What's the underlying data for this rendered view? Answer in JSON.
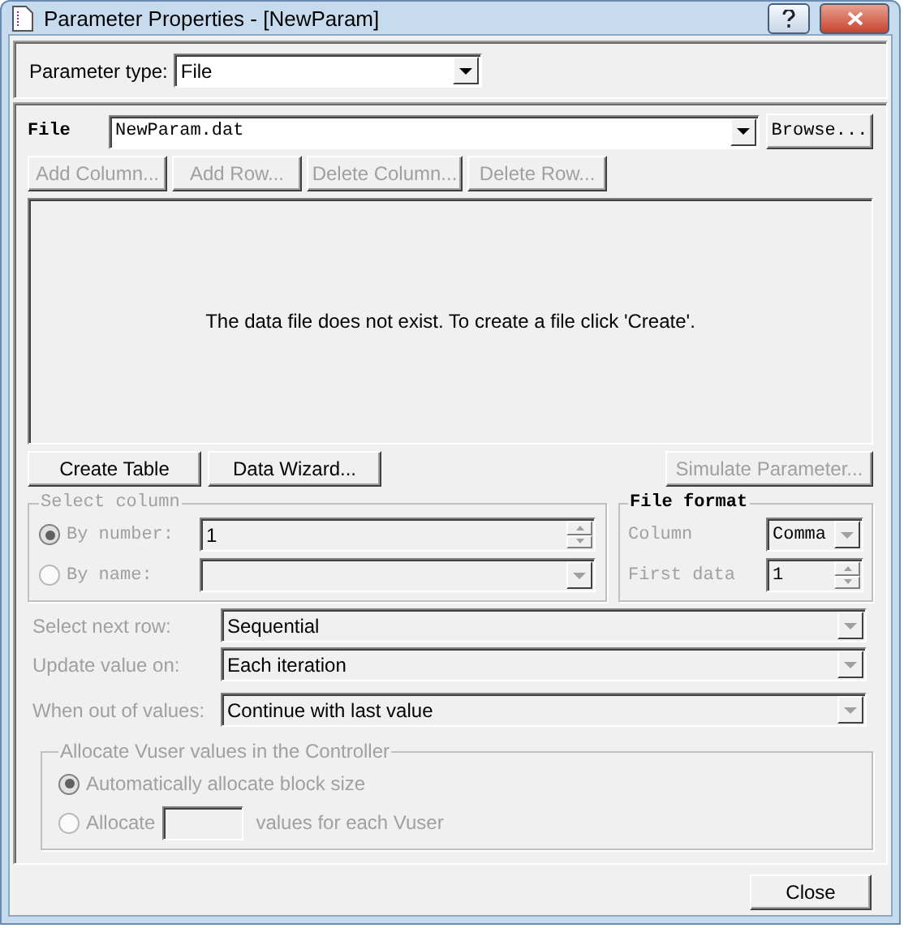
{
  "window": {
    "title": "Parameter Properties - [NewParam]"
  },
  "parameter_type": {
    "label": "Parameter type:",
    "value": "File"
  },
  "file": {
    "label": "File",
    "value": "NewParam.dat",
    "browse": "Browse..."
  },
  "table_buttons": [
    {
      "label": "Add Column...",
      "disabled": true
    },
    {
      "label": "Add Row...",
      "disabled": true
    },
    {
      "label": "Delete Column...",
      "disabled": true
    },
    {
      "label": "Delete Row...",
      "disabled": true
    }
  ],
  "table": {
    "message": "The data file does not exist. To create a file click 'Create'."
  },
  "action_buttons": [
    {
      "label": "Create Table",
      "disabled": false
    },
    {
      "label": "Data Wizard...",
      "disabled": false
    },
    {
      "label": "Simulate Parameter...",
      "disabled": true
    }
  ],
  "select_column": {
    "title": "Select column",
    "disabled": true,
    "options": [
      {
        "label": "By number:",
        "selected": true,
        "kind": "spin",
        "value": "1"
      },
      {
        "label": "By name:",
        "selected": false,
        "kind": "combo"
      }
    ]
  },
  "file_format": {
    "title": "File format",
    "column": {
      "label": "Column",
      "value": "Comma"
    },
    "first_data": {
      "label": "First data",
      "value": "1"
    }
  },
  "settings": [
    {
      "label": "Select next row:",
      "value": "Sequential"
    },
    {
      "label": "Update value on:",
      "value": "Each iteration"
    },
    {
      "label": "When out of values:",
      "value": "Continue with last value"
    }
  ],
  "allocate": {
    "title": "Allocate Vuser values in the Controller",
    "options": [
      {
        "label": "Automatically allocate block size",
        "selected": true
      },
      {
        "label": "Allocate",
        "selected": false,
        "suffix": "values for each Vuser"
      }
    ]
  },
  "close_button": "Close"
}
